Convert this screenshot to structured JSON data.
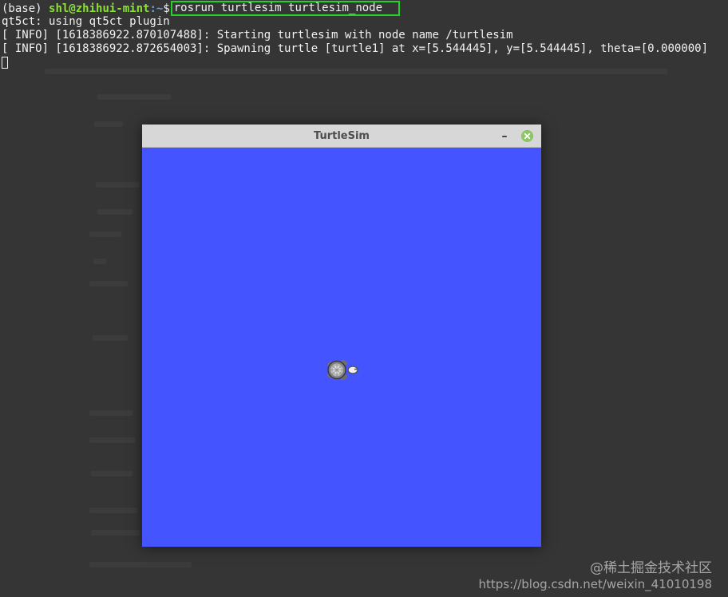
{
  "terminal": {
    "prompt_env": "(base) ",
    "prompt_user": "shl@zhihui-mint",
    "prompt_path": ":~",
    "prompt_symbol": "$",
    "command": "rosrun turtlesim turtlesim_node",
    "lines": [
      "qt5ct: using qt5ct plugin",
      "[ INFO] [1618386922.870107488]: Starting turtlesim with node name /turtlesim",
      "[ INFO] [1618386922.872654003]: Spawning turtle [turtle1] at x=[5.544445], y=[5.544445], theta=[0.000000]"
    ]
  },
  "window": {
    "title": "TurtleSim",
    "minimize_icon": "minimize-icon",
    "close_icon": "close-icon",
    "canvas_color": "#4455ff"
  },
  "watermark": {
    "brand": "@稀土掘金技术社区",
    "url": "https://blog.csdn.net/weixin_41010198"
  },
  "colors": {
    "terminal_bg": "#353535",
    "command_highlight": "#22d326",
    "prompt_user": "#8ae234",
    "prompt_path": "#729fcf",
    "titlebar": "#d7d7d7",
    "close_button": "#8fc46a"
  }
}
